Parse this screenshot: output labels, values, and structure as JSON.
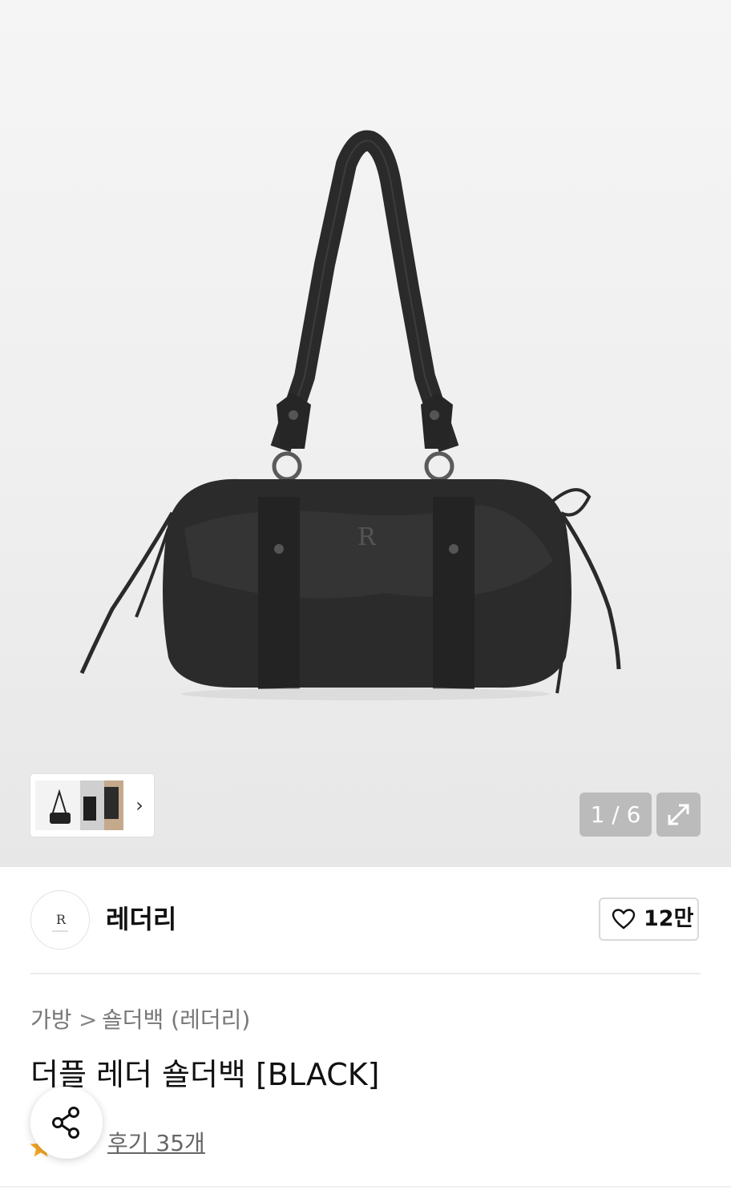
{
  "gallery": {
    "image_alt": "black leather shoulder bag",
    "counter": "1 / 6",
    "thumbnails": [
      "thumb-1",
      "thumb-2",
      "thumb-3"
    ],
    "next_icon": "chevron-right-icon",
    "expand_icon": "expand-icon"
  },
  "brand": {
    "name": "레더리",
    "logo_text": "R",
    "like_icon": "heart-icon",
    "like_count": "12만"
  },
  "breadcrumb": {
    "category": "가방",
    "separator": ">",
    "subcategory": "숄더백 (레더리)"
  },
  "product": {
    "title": "더플 레더 숄더백 [BLACK]",
    "review_link": "후기 35개"
  },
  "share": {
    "icon": "share-icon"
  },
  "colors": {
    "star": "#f5a623",
    "text": "#111111",
    "muted": "#777777"
  }
}
